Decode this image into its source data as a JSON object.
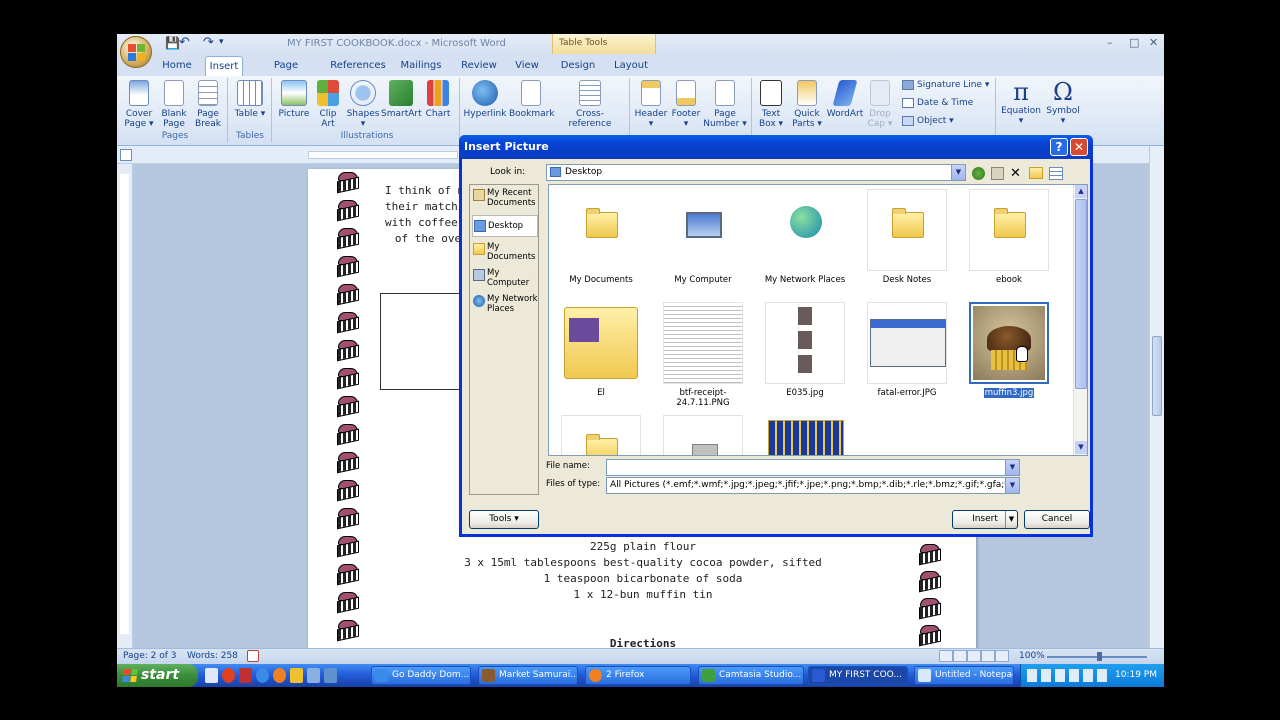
{
  "window": {
    "title": "MY FIRST COOKBOOK.docx - Microsoft Word",
    "context_tab": "Table Tools",
    "controls": [
      "–",
      "□",
      "✕"
    ]
  },
  "qat": {
    "save": "💾",
    "undo": "↶",
    "redo": "↷",
    "more": "▾"
  },
  "tabs": [
    {
      "label": "Home"
    },
    {
      "label": "Insert"
    },
    {
      "label": "Page Layout"
    },
    {
      "label": "References"
    },
    {
      "label": "Mailings"
    },
    {
      "label": "Review"
    },
    {
      "label": "View"
    },
    {
      "label": "Design"
    },
    {
      "label": "Layout"
    }
  ],
  "ribbon": {
    "pages": {
      "cover": "Cover Page ▾",
      "blank": "Blank Page",
      "break": "Page Break",
      "group": "Pages"
    },
    "tables": {
      "table": "Table ▾",
      "group": "Tables"
    },
    "illustrations": {
      "picture": "Picture",
      "clipart": "Clip Art",
      "shapes": "Shapes ▾",
      "smartart": "SmartArt",
      "chart": "Chart",
      "group": "Illustrations"
    },
    "links": {
      "hyperlink": "Hyperlink",
      "bookmark": "Bookmark",
      "crossref": "Cross-reference"
    },
    "headerfooter": {
      "header": "Header ▾",
      "footer": "Footer ▾",
      "pagenum": "Page Number ▾"
    },
    "text": {
      "textbox": "Text Box ▾",
      "quickparts": "Quick Parts ▾",
      "wordart": "WordArt",
      "dropcap": "Drop Cap ▾",
      "sigline": "Signature Line ▾",
      "datetime": "Date & Time",
      "object": "Object ▾"
    },
    "symbols": {
      "equation": "Equation ▾",
      "symbol": "Symbol ▾",
      "eq_glyph": "π",
      "sym_glyph": "Ω"
    }
  },
  "document": {
    "top_lines": [
      "I think of mu",
      "their matchin",
      "with coffee a",
      "of the ove"
    ],
    "ingredients": [
      "225g plain flour",
      "3 x 15ml tablespoons best-quality cocoa powder, sifted",
      "1 teaspoon bicarbonate of soda",
      "1 x 12-bun muffin tin"
    ],
    "directions": "Directions"
  },
  "dialog": {
    "title": "Insert Picture",
    "help": "?",
    "close": "✕",
    "look_in_label": "Look in:",
    "look_in_value": "Desktop",
    "places": [
      {
        "label": "My Recent Documents"
      },
      {
        "label": "Desktop"
      },
      {
        "label": "My Documents"
      },
      {
        "label": "My Computer"
      },
      {
        "label": "My Network Places"
      }
    ],
    "files": [
      {
        "label": "My Documents"
      },
      {
        "label": "My Computer"
      },
      {
        "label": "My Network Places"
      },
      {
        "label": "Desk Notes"
      },
      {
        "label": "ebook"
      },
      {
        "label": "El"
      },
      {
        "label": "btf-receipt-24.7.11.PNG"
      },
      {
        "label": "E035.jpg"
      },
      {
        "label": "fatal-error.JPG"
      },
      {
        "label": "muffin3.jpg"
      }
    ],
    "file_name_label": "File name:",
    "file_name_value": "",
    "files_of_type_label": "Files of type:",
    "files_of_type_value": "All Pictures (*.emf;*.wmf;*.jpg;*.jpeg;*.jfif;*.jpe;*.png;*.bmp;*.dib;*.rle;*.bmz;*.gif;*.gfa;*.emz",
    "tools": "Tools",
    "insert": "Insert",
    "cancel": "Cancel"
  },
  "status": {
    "page": "Page: 2 of 3",
    "words": "Words: 258",
    "zoom": "100%"
  },
  "taskbar": {
    "start": "start",
    "buttons": [
      {
        "label": "Go Daddy Dom..."
      },
      {
        "label": "Market Samurai..."
      },
      {
        "label": "2 Firefox"
      },
      {
        "label": "Camtasia Studio..."
      },
      {
        "label": "MY FIRST COO..."
      },
      {
        "label": "Untitled - Notepad"
      }
    ],
    "clock": "10:19 PM"
  }
}
